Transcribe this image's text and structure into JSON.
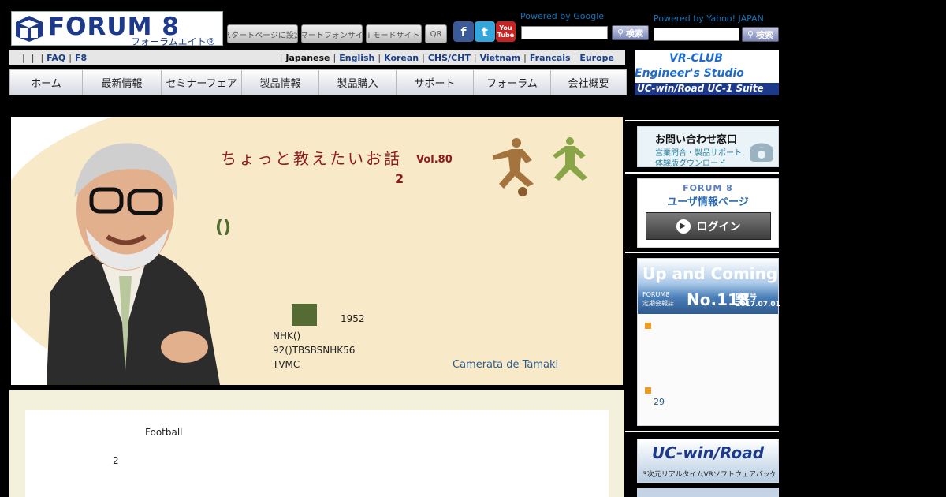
{
  "header": {
    "logo_text": "FORUM 8",
    "logo_sub": "フォーラムエイト®",
    "buttons": [
      "スタートページに設定",
      "スマートフォンサイト",
      "i モードサイト",
      "QR"
    ],
    "social": [
      "f",
      "t",
      "You Tube"
    ],
    "google_label": "Powered by Google",
    "yahoo_label": "Powered by Yahoo! JAPAN",
    "search_button": "検索",
    "search_button2": "検索"
  },
  "langbar": {
    "left": [
      "FAQ",
      "F8"
    ],
    "languages": [
      "Japanese",
      "English",
      "Korean",
      "CHS/CHT",
      "Vietnam",
      "Francais",
      "Europe"
    ]
  },
  "nav": [
    "ホーム",
    "最新情報",
    "セミナーフェア",
    "製品情報",
    "製品購入",
    "サポート",
    "フォーラム",
    "会社概要"
  ],
  "banners": {
    "vr_top": "VR-CLUB",
    "engineers": "Engineer's Studio",
    "ucwin": "UC-win/Road UC-1 Suite"
  },
  "hero": {
    "title": "ちょっと教えたいお話",
    "vol": "Vol.80",
    "sub": "2",
    "paren": "()",
    "year": "1952",
    "line1": "NHK()",
    "line2": "92()TBSBSNHK56",
    "line3": "TVMC",
    "link": "Camerata de Tamaki"
  },
  "content": {
    "football": "Football",
    "two": "2"
  },
  "sidebar": {
    "contact_title": "お問い合わせ窓口",
    "contact_sub1": "営業問合・製品サポート",
    "contact_sub2": "体験版ダウンロード",
    "user_logo": "FORUM 8",
    "user_title": "ユーザ情報ページ",
    "login": "ログイン",
    "uac_title": "Up and Coming",
    "uac_small1": "FORUM8",
    "uac_small2": "定期会報誌",
    "uac_no": "No.118",
    "uac_season": "盛夏号",
    "uac_date": "2017.07.01",
    "uac_num": "29",
    "ucwin_title": "UC-win/Road",
    "ucwin_sub": "3次元リアルタイムVRソフトウェアパッケージ"
  },
  "colors": {
    "bubble": "#f8e9c8",
    "title_red": "#8e1b1b",
    "link_blue": "#1a3f8a",
    "accent_orange": "#f39a1e"
  }
}
